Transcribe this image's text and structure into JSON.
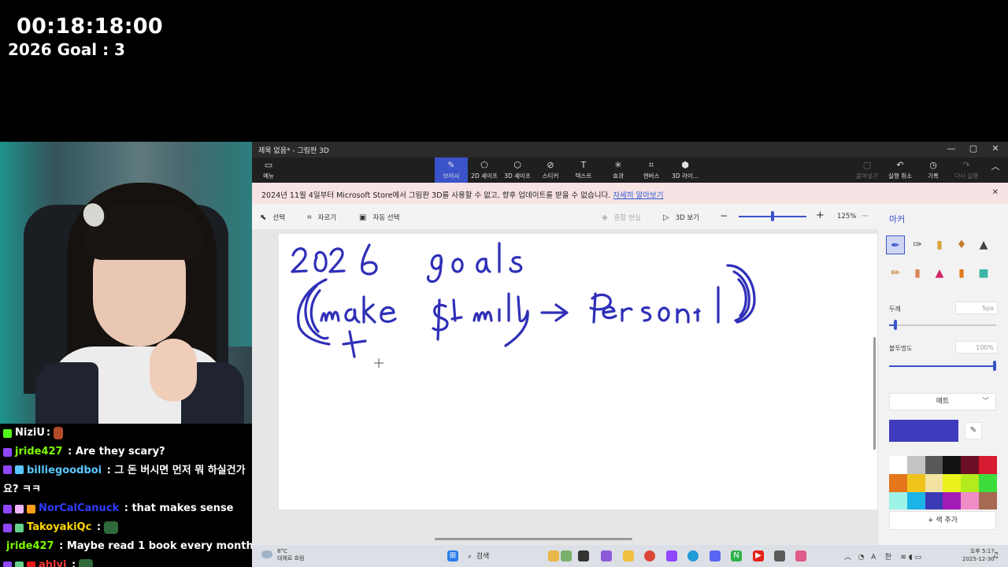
{
  "overlay": {
    "timer": "00:18:18:00",
    "goal": "2026 Goal : 3"
  },
  "chat": [
    {
      "badges": [
        "kick"
      ],
      "user": "NiziU",
      "user_color": "#ffffff",
      "text": "",
      "emote": "tree"
    },
    {
      "badges": [
        "twitch"
      ],
      "user": "jride427",
      "user_color": "#7cfc00",
      "text": "Are they scary?"
    },
    {
      "badges": [
        "twitch",
        "tv"
      ],
      "user": "billiegoodboi",
      "user_color": "#5ac8ff",
      "text": "그 돈 버시면 먼저 뭐 하실건가요? ㅋㅋ"
    },
    {
      "badges": [
        "twitch",
        "sub",
        "gift"
      ],
      "user": "NorCalCanuck",
      "user_color": "#2e3cff",
      "text": "that makes sense"
    },
    {
      "badges": [
        "twitch",
        "clover"
      ],
      "user": "TakoyakiQc",
      "user_color": "#ffd700",
      "text": "",
      "emote": "frog"
    },
    {
      "badges": [
        "twitch"
      ],
      "user": "jride427",
      "user_color": "#7cfc00",
      "text": "Maybe read 1 book every month?"
    },
    {
      "badges": [
        "twitch",
        "clover",
        "x"
      ],
      "user": "ahlyi",
      "user_color": "#ff3b3b",
      "text": "",
      "emote": "frog"
    }
  ],
  "app": {
    "title": "제목 없음* - 그림판 3D",
    "window_buttons": [
      "—",
      "▢",
      "✕"
    ],
    "menu": {
      "icon": "folder-icon",
      "label": "메뉴"
    },
    "tools": [
      {
        "name": "brushes",
        "icon": "brush-icon",
        "label": "브러시",
        "active": true
      },
      {
        "name": "2d-shapes",
        "icon": "2d-shape-icon",
        "label": "2D 셰이프"
      },
      {
        "name": "3d-shapes",
        "icon": "cube-icon",
        "label": "3D 셰이프"
      },
      {
        "name": "stickers",
        "icon": "sticker-icon",
        "label": "스티커"
      },
      {
        "name": "text",
        "icon": "text-icon",
        "label": "텍스트"
      },
      {
        "name": "effects",
        "icon": "sparkle-icon",
        "label": "효과"
      },
      {
        "name": "canvas",
        "icon": "canvas-icon",
        "label": "캔버스"
      },
      {
        "name": "3d-library",
        "icon": "library-icon",
        "label": "3D 라이..."
      }
    ],
    "history": [
      {
        "name": "paste",
        "icon": "paste-icon",
        "label": "붙여넣기",
        "dim": true
      },
      {
        "name": "undo",
        "icon": "undo-icon",
        "label": "실행 취소"
      },
      {
        "name": "history",
        "icon": "history-icon",
        "label": "기록"
      },
      {
        "name": "redo",
        "icon": "redo-icon",
        "label": "다시 실행",
        "dim": true
      }
    ],
    "banner": {
      "text": "2024년 11월 4일부터 Microsoft Store에서 그림판 3D를 사용할 수 없고, 향후 업데이트를 받을 수 없습니다.",
      "link": "자세히 알아보기"
    },
    "subtoolbar": {
      "select": "선택",
      "crop": "자르기",
      "magic_select": "자동 선택",
      "mixed_reality": "혼합 현실",
      "view_3d": "3D 보기",
      "zoom": "125%",
      "more": "···"
    },
    "canvas_strokes": {
      "line1": "2026 goals",
      "line2": "make $1 mil → personal",
      "color": "#2f2fb8"
    },
    "panel": {
      "title": "마커",
      "thickness_label": "두께",
      "thickness_value": "5px",
      "opacity_label": "불투명도",
      "opacity_value": "100%",
      "opacity_level": 1.0,
      "finish": "매트",
      "current_color": "#3f3bbd",
      "swatches": [
        "#ffffff",
        "#c3c3c3",
        "#585858",
        "#111111",
        "#6b1024",
        "#d81b32",
        "#e4761b",
        "#f0c21c",
        "#f3e3a0",
        "#e9f21c",
        "#b3ec1c",
        "#3ddc3d",
        "#9ef3e8",
        "#1cb4e7",
        "#3a3ab5",
        "#a21cb5",
        "#f08cc6",
        "#a76a52"
      ],
      "add_color": "+ 색 추가"
    }
  },
  "taskbar": {
    "weather_temp": "8°C",
    "weather_text": "대체로 흐림",
    "search": "검색",
    "clock_time": "오후 5:17",
    "clock_date": "2025-12-30",
    "ime_a": "A",
    "ime_han": "한"
  }
}
